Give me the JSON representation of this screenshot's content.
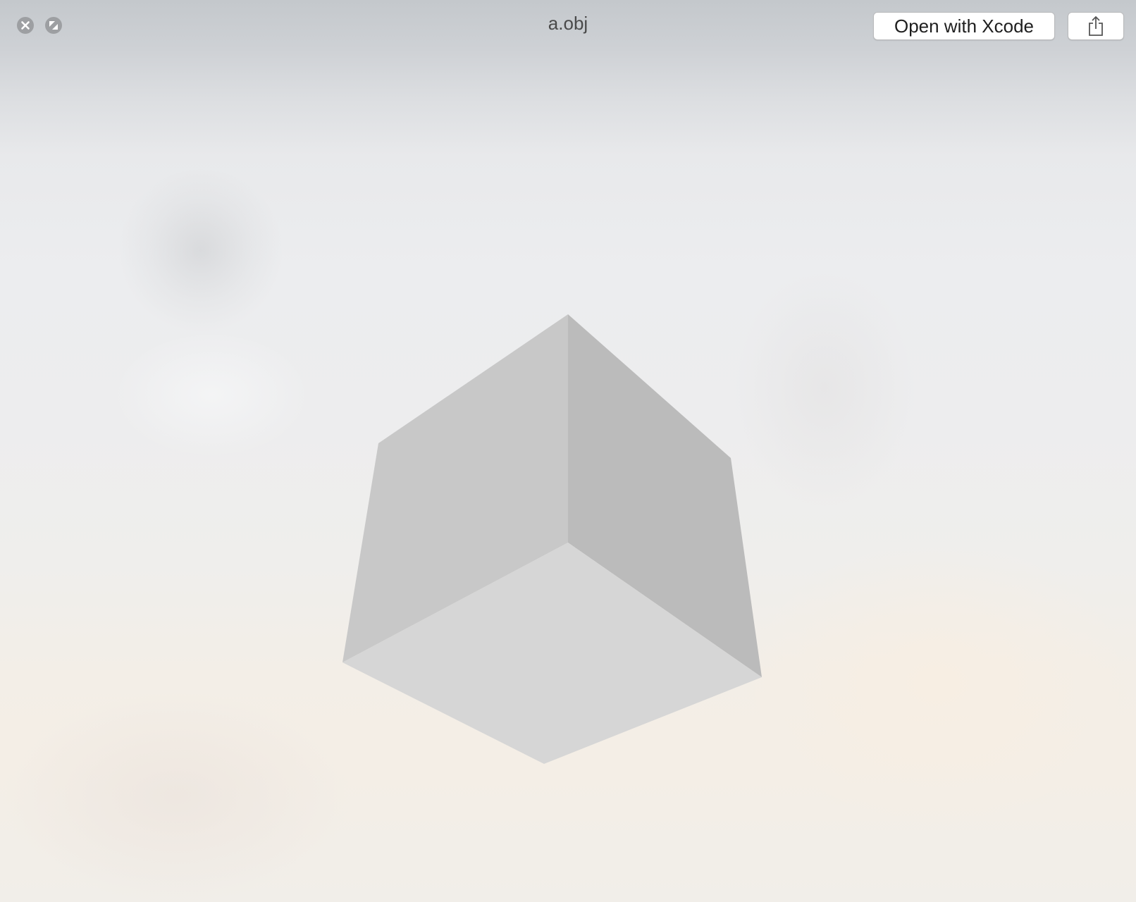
{
  "window": {
    "title": "a.obj"
  },
  "toolbar": {
    "open_with_label": "Open with Xcode",
    "share_icon": "share-icon",
    "close_icon": "close-icon",
    "fullscreen_icon": "fullscreen-icon"
  },
  "preview": {
    "object": "cube",
    "face_colors": {
      "left": "#c8c8c8",
      "right": "#bbbbbb",
      "bottom": "#d6d6d6"
    }
  }
}
